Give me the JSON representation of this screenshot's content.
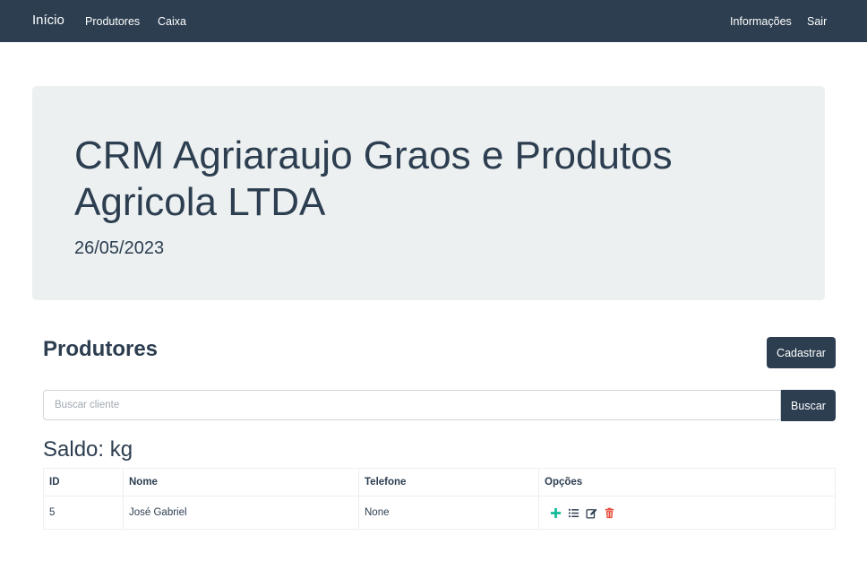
{
  "navbar": {
    "brand": "Início",
    "left_links": [
      "Produtores",
      "Caixa"
    ],
    "right_links": [
      "Informações",
      "Sair"
    ]
  },
  "jumbotron": {
    "title": "CRM Agriaraujo Graos e Produtos Agricola LTDA",
    "date": "26/05/2023"
  },
  "producers": {
    "title": "Produtores",
    "register_button": "Cadastrar",
    "search": {
      "placeholder": "Buscar cliente",
      "value": "",
      "button": "Buscar"
    },
    "balance": "Saldo: kg",
    "table": {
      "headers": [
        "ID",
        "Nome",
        "Telefone",
        "Opções"
      ],
      "rows": [
        {
          "id": "5",
          "nome": "José Gabriel",
          "telefone": "None",
          "options": [
            "plus-icon",
            "list-icon",
            "edit-icon",
            "trash-icon"
          ]
        }
      ]
    }
  },
  "colors": {
    "primary": "#2c3e50",
    "light": "#ecf0f1",
    "success": "#18bc9c",
    "danger": "#e74c3c"
  }
}
